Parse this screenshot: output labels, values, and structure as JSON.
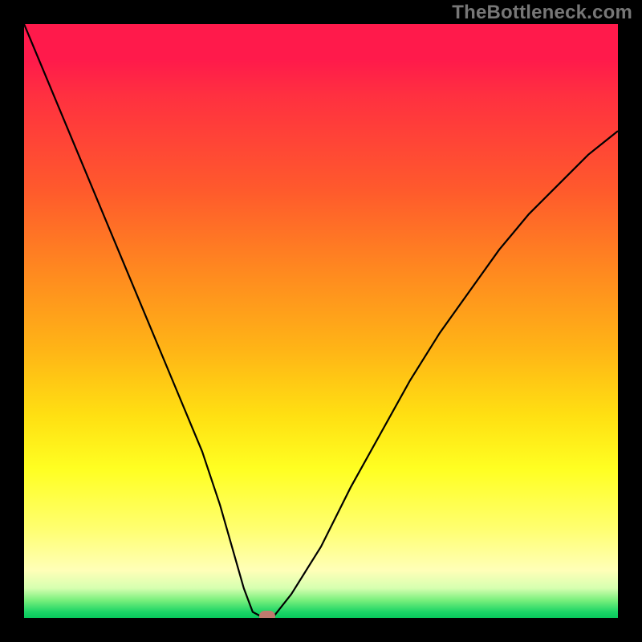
{
  "watermark": "TheBottleneck.com",
  "chart_data": {
    "type": "line",
    "title": "",
    "xlabel": "",
    "ylabel": "",
    "xlim": [
      0,
      100
    ],
    "ylim": [
      0,
      100
    ],
    "series": [
      {
        "name": "curve",
        "x": [
          0,
          5,
          10,
          15,
          20,
          25,
          30,
          33,
          35,
          37,
          38.5,
          40,
          41,
          42,
          45,
          50,
          55,
          60,
          65,
          70,
          75,
          80,
          85,
          90,
          95,
          100
        ],
        "y": [
          100,
          88,
          76,
          64,
          52,
          40,
          28,
          19,
          12,
          5,
          1,
          0.2,
          0.3,
          0.2,
          4,
          12,
          22,
          31,
          40,
          48,
          55,
          62,
          68,
          73,
          78,
          82
        ]
      }
    ],
    "marker": {
      "x": 41,
      "y": 0.3
    },
    "background_gradient": {
      "top": "#ff1a4b",
      "mid": "#ffe012",
      "bottom": "#08c85c"
    }
  }
}
